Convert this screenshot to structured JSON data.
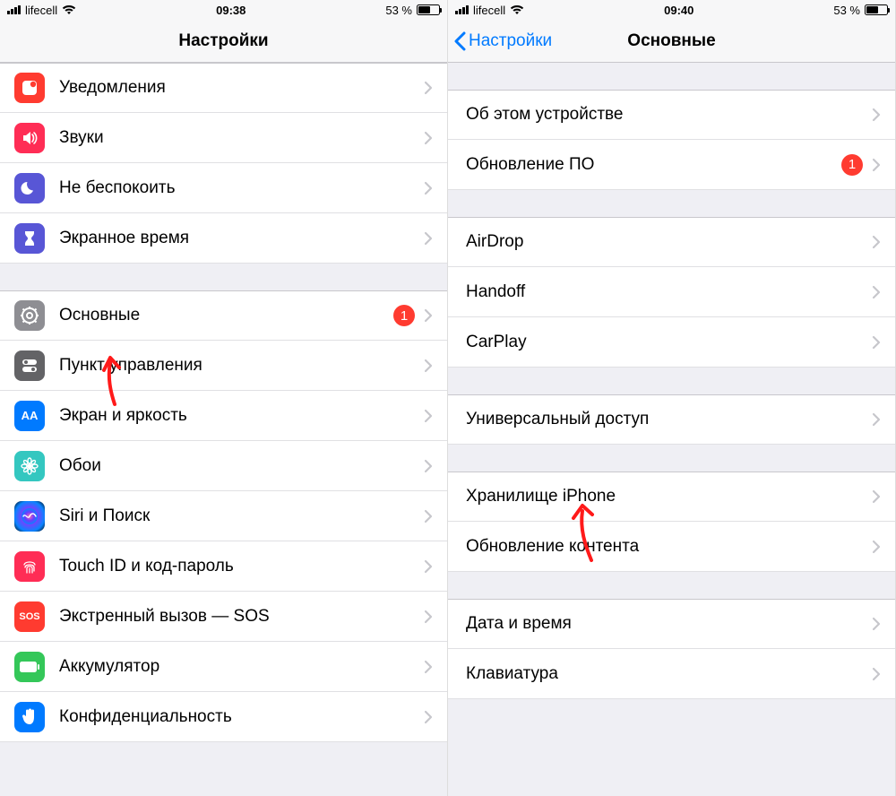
{
  "left": {
    "status": {
      "carrier": "lifecell",
      "time": "09:38",
      "battery_pct": "53 %"
    },
    "nav": {
      "title": "Настройки"
    },
    "groups": [
      [
        {
          "key": "notifications",
          "label": "Уведомления",
          "icon": "notifications-icon",
          "bg": "bg-red"
        },
        {
          "key": "sounds",
          "label": "Звуки",
          "icon": "speaker-icon",
          "bg": "bg-redpink"
        },
        {
          "key": "dnd",
          "label": "Не беспокоить",
          "icon": "moon-icon",
          "bg": "bg-purple"
        },
        {
          "key": "screentime",
          "label": "Экранное время",
          "icon": "hourglass-icon",
          "bg": "bg-purple"
        }
      ],
      [
        {
          "key": "general",
          "label": "Основные",
          "icon": "gear-icon",
          "bg": "bg-gray",
          "badge": "1"
        },
        {
          "key": "controlcenter",
          "label": "Пункт управления",
          "icon": "switches-icon",
          "bg": "bg-darkgray"
        },
        {
          "key": "display",
          "label": "Экран и яркость",
          "icon": "text-size-icon",
          "bg": "bg-blue",
          "iconText": "AA"
        },
        {
          "key": "wallpaper",
          "label": "Обои",
          "icon": "flower-icon",
          "bg": "bg-teal"
        },
        {
          "key": "siri",
          "label": "Siri и Поиск",
          "icon": "siri-icon",
          "bg": "siri-bg"
        },
        {
          "key": "touchid",
          "label": "Touch ID и код-пароль",
          "icon": "fingerprint-icon",
          "bg": "bg-redpink"
        },
        {
          "key": "sos",
          "label": "Экстренный вызов — SOS",
          "icon": "sos-icon",
          "bg": "bg-red",
          "iconText": "SOS"
        },
        {
          "key": "battery",
          "label": "Аккумулятор",
          "icon": "battery-icon",
          "bg": "bg-green"
        },
        {
          "key": "privacy",
          "label": "Конфиденциальность",
          "icon": "hand-icon",
          "bg": "bg-hand"
        }
      ]
    ]
  },
  "right": {
    "status": {
      "carrier": "lifecell",
      "time": "09:40",
      "battery_pct": "53 %"
    },
    "nav": {
      "back": "Настройки",
      "title": "Основные"
    },
    "groups": [
      [
        {
          "key": "about",
          "label": "Об этом устройстве"
        },
        {
          "key": "update",
          "label": "Обновление ПО",
          "badge": "1"
        }
      ],
      [
        {
          "key": "airdrop",
          "label": "AirDrop"
        },
        {
          "key": "handoff",
          "label": "Handoff"
        },
        {
          "key": "carplay",
          "label": "CarPlay"
        }
      ],
      [
        {
          "key": "accessibility",
          "label": "Универсальный доступ"
        }
      ],
      [
        {
          "key": "storage",
          "label": "Хранилище iPhone"
        },
        {
          "key": "backgroundrefresh",
          "label": "Обновление контента"
        }
      ],
      [
        {
          "key": "datetime",
          "label": "Дата и время"
        },
        {
          "key": "keyboard",
          "label": "Клавиатура"
        }
      ]
    ]
  }
}
